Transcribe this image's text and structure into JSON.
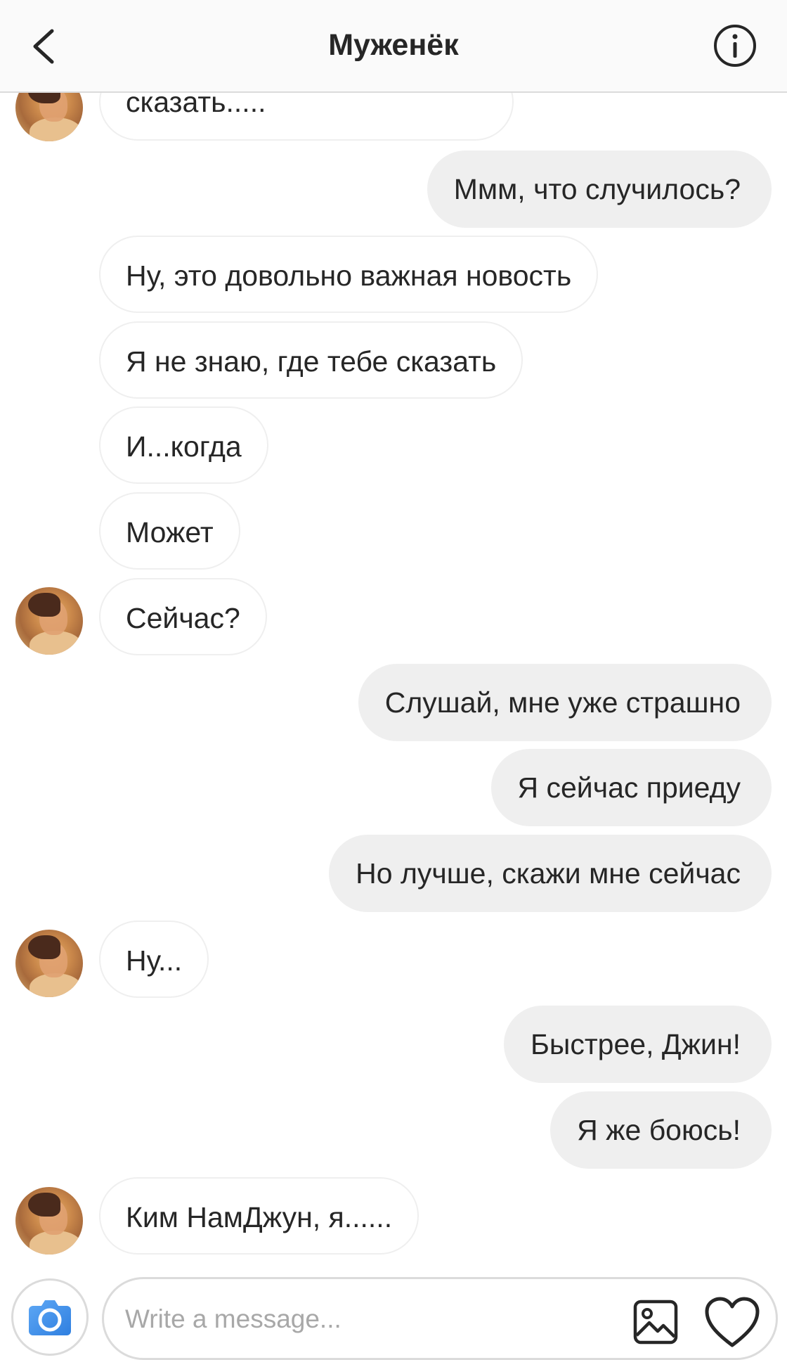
{
  "header": {
    "title": "Муженёк",
    "back_icon": "chevron-left-icon",
    "info_icon": "info-circle-icon"
  },
  "messages": [
    {
      "side": "in",
      "text": "сказать.....",
      "avatar": true
    },
    {
      "side": "out",
      "text": "Ммм, что случилось?"
    },
    {
      "side": "in",
      "text": "Ну, это довольно важная новость",
      "avatar": false
    },
    {
      "side": "in",
      "text": "Я не знаю, где тебе сказать",
      "avatar": false
    },
    {
      "side": "in",
      "text": "И...когда",
      "avatar": false
    },
    {
      "side": "in",
      "text": "Может",
      "avatar": false
    },
    {
      "side": "in",
      "text": "Сейчас?",
      "avatar": true
    },
    {
      "side": "out",
      "text": "Слушай, мне уже страшно"
    },
    {
      "side": "out",
      "text": "Я сейчас приеду"
    },
    {
      "side": "out",
      "text": "Но лучше, скажи мне сейчас"
    },
    {
      "side": "in",
      "text": "Ну...",
      "avatar": true
    },
    {
      "side": "out",
      "text": "Быстрее, Джин!"
    },
    {
      "side": "out",
      "text": "Я же боюсь!"
    },
    {
      "side": "in",
      "text": "Ким НамДжун, я......",
      "avatar": true
    }
  ],
  "composer": {
    "placeholder": "Write a message...",
    "camera_icon": "camera-icon",
    "gallery_icon": "gallery-icon",
    "like_icon": "heart-icon"
  },
  "colors": {
    "accent": "#3897f0",
    "outgoing_bubble": "#efefef",
    "incoming_border": "#efefef",
    "text": "#262626",
    "placeholder": "#a8a8a8"
  }
}
